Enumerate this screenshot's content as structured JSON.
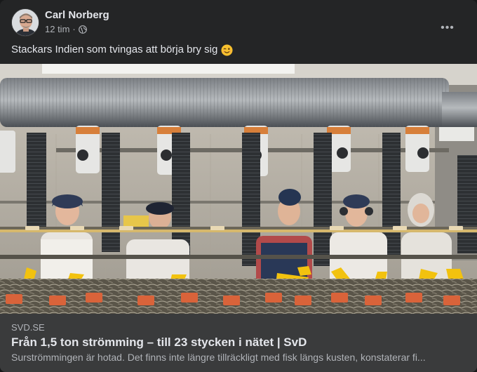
{
  "post": {
    "author": "Carl Norberg",
    "time": "12 tim",
    "separator": "·",
    "audience_icon": "globe-icon",
    "more_icon": "more-options-icon",
    "more_label": "•••",
    "text": "Stackars Indien som tvingas att börja bry sig",
    "emoji": "winking-face-emoji"
  },
  "link_preview": {
    "domain": "SVD.SE",
    "title": "Från 1,5 ton strömming – till 23 stycken i nätet | SvD",
    "description": "Surströmmingen är hotad. Det finns inte längre tillräckligt med fisk längs kusten, konstaterar fi..."
  },
  "colors": {
    "card_bg": "#242526",
    "link_bg": "#3a3b3c",
    "primary_text": "#e4e6eb",
    "secondary_text": "#b0b3b8",
    "glove_yellow": "#f2c20f"
  }
}
